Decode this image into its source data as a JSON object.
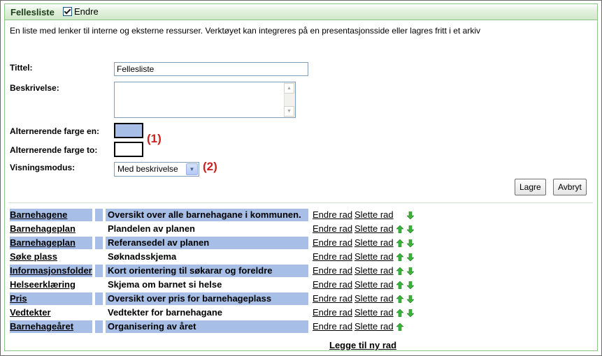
{
  "header": {
    "title": "Fellesliste",
    "edit_label": "Endre"
  },
  "description": "En liste med lenker til interne og eksterne ressurser. Verktøyet kan integreres på en presentasjonsside eller lagres fritt i et arkiv",
  "form": {
    "title_label": "Tittel:",
    "title_value": "Fellesliste",
    "description_label": "Beskrivelse:",
    "color1_label": "Alternerende farge en:",
    "color1_value": "#a7bfe6",
    "color2_label": "Alternerende farge to:",
    "color2_value": "#ffffff",
    "annotation1": "(1)",
    "mode_label": "Visningsmodus:",
    "mode_value": "Med beskrivelse",
    "annotation2": "(2)",
    "save_label": "Lagre",
    "cancel_label": "Avbryt"
  },
  "rows": [
    {
      "name": "Barnehagene",
      "desc": "Oversikt over alle barnehagane i kommunen.",
      "edit": "Endre rad",
      "delete": "Slette rad",
      "up": false,
      "down": true
    },
    {
      "name": "Barnehageplan",
      "desc": "Plandelen av planen",
      "edit": "Endre rad",
      "delete": "Slette rad",
      "up": true,
      "down": true
    },
    {
      "name": "Barnehageplan",
      "desc": "Referansedel av planen",
      "edit": "Endre rad",
      "delete": "Slette rad",
      "up": true,
      "down": true
    },
    {
      "name": "Søke plass",
      "desc": "Søknadsskjema",
      "edit": "Endre rad",
      "delete": "Slette rad",
      "up": true,
      "down": true
    },
    {
      "name": "Informasjonsfolder",
      "desc": "Kort orientering til søkarar og foreldre",
      "edit": "Endre rad",
      "delete": "Slette rad",
      "up": true,
      "down": true
    },
    {
      "name": "Helseerklæring",
      "desc": "Skjema om barnet si helse",
      "edit": "Endre rad",
      "delete": "Slette rad",
      "up": true,
      "down": true
    },
    {
      "name": "Pris",
      "desc": "Oversikt over pris for barnehageplass",
      "edit": "Endre rad",
      "delete": "Slette rad",
      "up": true,
      "down": true
    },
    {
      "name": "Vedtekter",
      "desc": "Vedtekter for barnehagane",
      "edit": "Endre rad",
      "delete": "Slette rad",
      "up": true,
      "down": true
    },
    {
      "name": "Barnehageåret",
      "desc": "Organisering av året",
      "edit": "Endre rad",
      "delete": "Slette rad",
      "up": true,
      "down": false
    }
  ],
  "add_row_label": "Legge til ny rad",
  "colors": {
    "accent_green": "#8fc48a",
    "row_alt": "#a7bfe6",
    "annotation_red": "#cc1f1f",
    "arrow_green": "#3bb33b"
  }
}
